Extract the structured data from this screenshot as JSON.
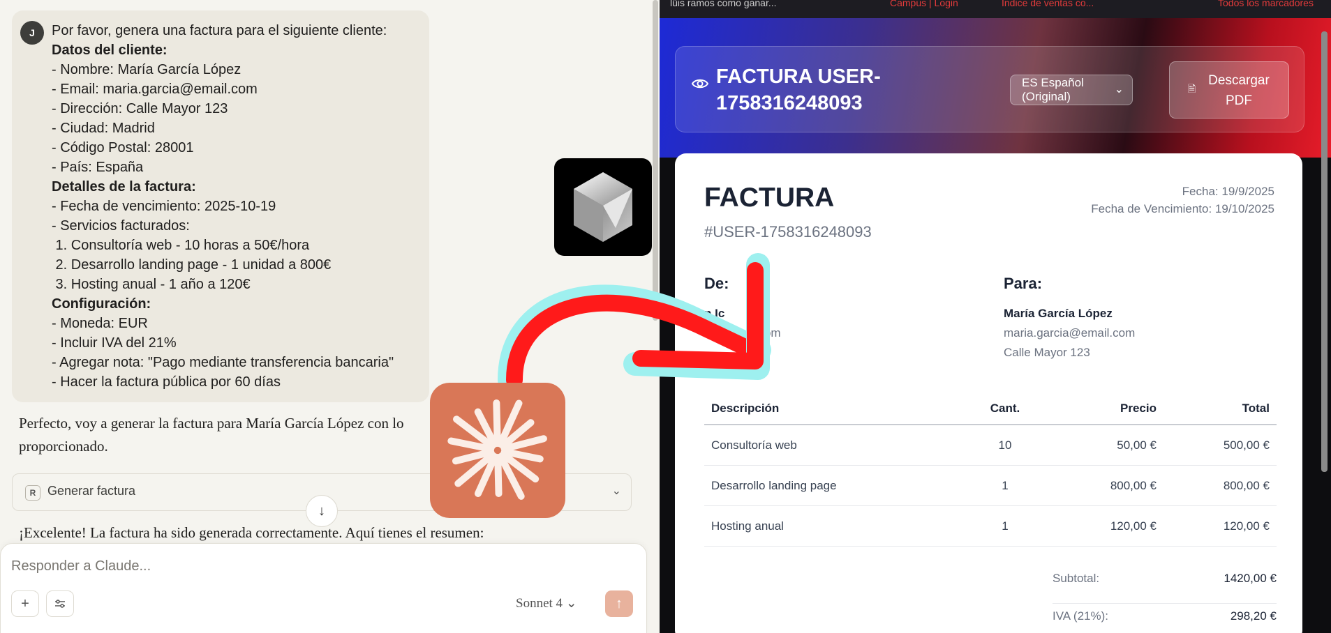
{
  "chat": {
    "avatar_initial": "J",
    "user_message_lines": [
      {
        "text": "Por favor, genera una factura para el siguiente cliente:",
        "bold": false
      },
      {
        "text": "Datos del cliente:",
        "bold": true
      },
      {
        "text": "- Nombre: María García López",
        "bold": false
      },
      {
        "text": "- Email: maria.garcia@email.com",
        "bold": false
      },
      {
        "text": "- Dirección: Calle Mayor 123",
        "bold": false
      },
      {
        "text": "- Ciudad: Madrid",
        "bold": false
      },
      {
        "text": "- Código Postal: 28001",
        "bold": false
      },
      {
        "text": "- País: España",
        "bold": false
      },
      {
        "text": "Detalles de la factura:",
        "bold": true
      },
      {
        "text": "- Fecha de vencimiento: 2025-10-19",
        "bold": false
      },
      {
        "text": "- Servicios facturados:",
        "bold": false
      },
      {
        "text": " 1. Consultoría web - 10 horas a 50€/hora",
        "bold": false
      },
      {
        "text": " 2. Desarrollo landing page - 1 unidad a 800€",
        "bold": false
      },
      {
        "text": " 3. Hosting anual - 1 año a 120€",
        "bold": false
      },
      {
        "text": "Configuración:",
        "bold": true
      },
      {
        "text": "- Moneda: EUR",
        "bold": false
      },
      {
        "text": "- Incluir IVA del 21%",
        "bold": false
      },
      {
        "text": "- Agregar nota: \"Pago mediante transferencia bancaria\"",
        "bold": false
      },
      {
        "text": "- Hacer la factura pública por 60 días",
        "bold": false
      }
    ],
    "assistant_reply_line1": "Perfecto, voy a generar la factura para María García López con lo",
    "assistant_reply_line2": "proporcionado.",
    "tool_badge": "R",
    "tool_label": "Generar factura",
    "result_text": "¡Excelente! La factura ha sido generada correctamente. Aquí tienes el resumen:",
    "composer_placeholder": "Responder a Claude...",
    "model_name": "Sonnet 4"
  },
  "browser_tabs": [
    {
      "label": "lüis ramos como ganar...",
      "color": "#d0d0d0"
    },
    {
      "label": "Campus | Login",
      "color": "#e33b3b"
    },
    {
      "label": "Índice de ventas co...",
      "color": "#e33b3b"
    },
    {
      "label": "Todos los marcadores",
      "color": "#e33b3b"
    }
  ],
  "header": {
    "title": "FACTURA USER-1758316248093",
    "language": "ES Español (Original)",
    "download_label": "Descargar PDF"
  },
  "invoice": {
    "heading": "FACTURA",
    "number": "#USER-1758316248093",
    "date": "Fecha: 19/9/2025",
    "due_date": "Fecha de Vencimiento: 19/10/2025",
    "from_label": "De:",
    "from_name": "n Ic",
    "from_email": "i        mail.com",
    "to_label": "Para:",
    "to_name": "María García López",
    "to_email": "maria.garcia@email.com",
    "to_address": "Calle Mayor 123",
    "columns": [
      "Descripción",
      "Cant.",
      "Precio",
      "Total"
    ],
    "items": [
      {
        "desc": "Consultoría web",
        "qty": "10",
        "price": "50,00 €",
        "total": "500,00 €"
      },
      {
        "desc": "Desarrollo landing page",
        "qty": "1",
        "price": "800,00 €",
        "total": "800,00 €"
      },
      {
        "desc": "Hosting anual",
        "qty": "1",
        "price": "120,00 €",
        "total": "120,00 €"
      }
    ],
    "subtotal_label": "Subtotal:",
    "subtotal": "1420,00 €",
    "tax_label": "IVA (21%):",
    "tax": "298,20 €"
  }
}
